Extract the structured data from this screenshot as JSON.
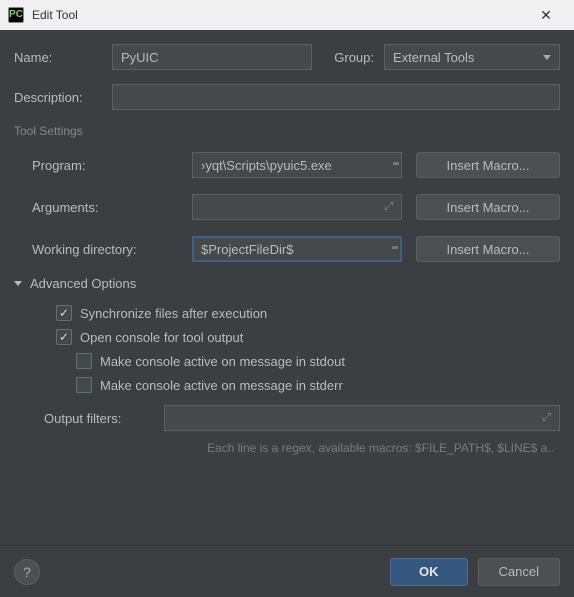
{
  "title": "Edit Tool",
  "name": {
    "label": "Name:",
    "value": "PyUIC"
  },
  "group": {
    "label": "Group:",
    "value": "External Tools"
  },
  "description": {
    "label": "Description:",
    "value": ""
  },
  "toolSettings": {
    "heading": "Tool Settings",
    "program": {
      "label": "Program:",
      "value": "›yqt\\Scripts\\pyuic5.exe",
      "button": "Insert Macro..."
    },
    "arguments": {
      "label": "Arguments:",
      "value": "",
      "button": "Insert Macro..."
    },
    "workingDir": {
      "label": "Working directory:",
      "value": "$ProjectFileDir$",
      "button": "Insert Macro..."
    }
  },
  "advanced": {
    "heading": "Advanced Options",
    "syncFiles": "Synchronize files after execution",
    "openConsole": "Open console for tool output",
    "stdoutActive": "Make console active on message in stdout",
    "stderrActive": "Make console active on message in stderr",
    "outputFilters": {
      "label": "Output filters:",
      "value": ""
    },
    "hint": "Each line is a regex, available macros: $FILE_PATH$, $LINE$ a.."
  },
  "buttons": {
    "ok": "OK",
    "cancel": "Cancel",
    "help": "?"
  }
}
